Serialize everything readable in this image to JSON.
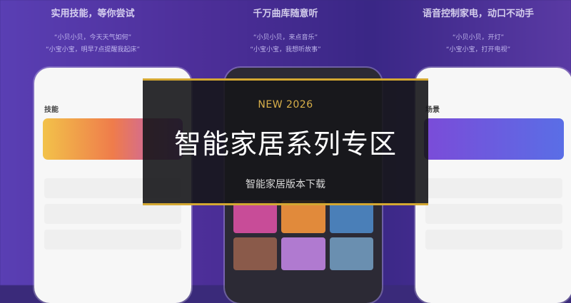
{
  "panels": [
    {
      "heading": "实用技能，等你尝试",
      "lines": [
        "“小贝小贝，今天天气如何”",
        "“小宝小宝，明早7点提醒我起床”"
      ],
      "phone_title": "技能"
    },
    {
      "heading": "千万曲库随意听",
      "lines": [
        "“小贝小贝，来点音乐”",
        "“小宝小宝，我想听故事”"
      ],
      "phone_title": ""
    },
    {
      "heading": "语音控制家电，动口不动手",
      "lines": [
        "“小贝小贝，开灯”",
        "“小宝小宝，打开电视”"
      ],
      "phone_title": "场景"
    }
  ],
  "overlay": {
    "kicker": "NEW 2026",
    "title": "智能家居系列专区",
    "subtitle": "智能家居版本下载"
  },
  "colors": {
    "accent": "#d4a832",
    "background": "#4d2f99"
  }
}
